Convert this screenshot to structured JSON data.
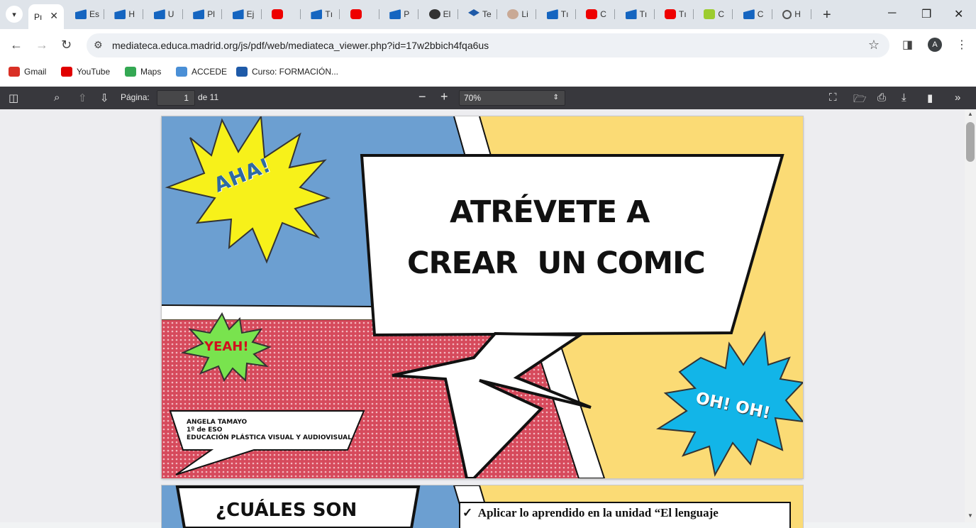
{
  "browser": {
    "active_tab": {
      "label": "Pı",
      "close": "✕"
    },
    "tabs": [
      {
        "label": "Es",
        "icon": "clapper-icon"
      },
      {
        "label": "H",
        "icon": "clapper-icon"
      },
      {
        "label": "U",
        "icon": "clapper-icon"
      },
      {
        "label": "Pl",
        "icon": "clapper-icon"
      },
      {
        "label": "Ej",
        "icon": "clapper-icon"
      },
      {
        "label": "",
        "icon": "youtube-icon"
      },
      {
        "label": "Tı",
        "icon": "clapper-icon"
      },
      {
        "label": "",
        "icon": "youtube-icon"
      },
      {
        "label": "P",
        "icon": "clapper-icon"
      },
      {
        "label": "El",
        "icon": "google-icon"
      },
      {
        "label": "Te",
        "icon": "graduation-cap-icon"
      },
      {
        "label": "Li",
        "icon": "brain-icon"
      },
      {
        "label": "Tı",
        "icon": "clapper-icon"
      },
      {
        "label": "C",
        "icon": "youtube-icon"
      },
      {
        "label": "Tı",
        "icon": "clapper-icon"
      },
      {
        "label": "Tı",
        "icon": "youtube-icon"
      },
      {
        "label": "C",
        "icon": "smiley-icon"
      },
      {
        "label": "C",
        "icon": "clapper-icon"
      },
      {
        "label": "H",
        "icon": "history-icon"
      }
    ],
    "url": "mediateca.educa.madrid.org/js/pdf/web/mediateca_viewer.php?id=17w2bbich4fqa6us",
    "avatar_letter": "A",
    "bookmarks": [
      {
        "label": "Gmail",
        "icon": "gmail-icon",
        "color": "#d93025"
      },
      {
        "label": "YouTube",
        "icon": "youtube-icon",
        "color": "#e00000"
      },
      {
        "label": "Maps",
        "icon": "maps-pin-icon",
        "color": "#34a853"
      },
      {
        "label": "ACCEDE",
        "icon": "accede-icon",
        "color": "#4a8fd6"
      },
      {
        "label": "Curso: FORMACIÓN...",
        "icon": "graduation-cap-icon",
        "color": "#1e5aa8"
      }
    ]
  },
  "pdf_toolbar": {
    "page_label": "Página:",
    "page_value": "1",
    "page_total": "de 11",
    "zoom_value": "70%",
    "zoom_out": "−",
    "zoom_in": "+"
  },
  "page1": {
    "title_line1": "ATRÉVETE A",
    "title_line2": "CREAR  UN COMIC",
    "aha": "AHA!",
    "yeah": "YEAH!",
    "oh": "OH! OH!",
    "author_line1": "ANGELA TAMAYO",
    "author_line2": "1º de ESO",
    "author_line3": "EDUCACIÓN PLÁSTICA VISUAL Y AUDIOVISUAL"
  },
  "page2": {
    "heading": "¿CUÁLES SON",
    "bullet": "✓  Aplicar lo aprendido en la unidad “El lenguaje"
  },
  "colors": {
    "pdf_toolbar_bg": "#38383d",
    "comic_blue": "#6c9fd1",
    "comic_yellow": "#fbdb75",
    "comic_red": "#d64a5c",
    "burst_yellow": "#f7f11a",
    "burst_green": "#79e34e",
    "burst_blue": "#12b5e8"
  }
}
